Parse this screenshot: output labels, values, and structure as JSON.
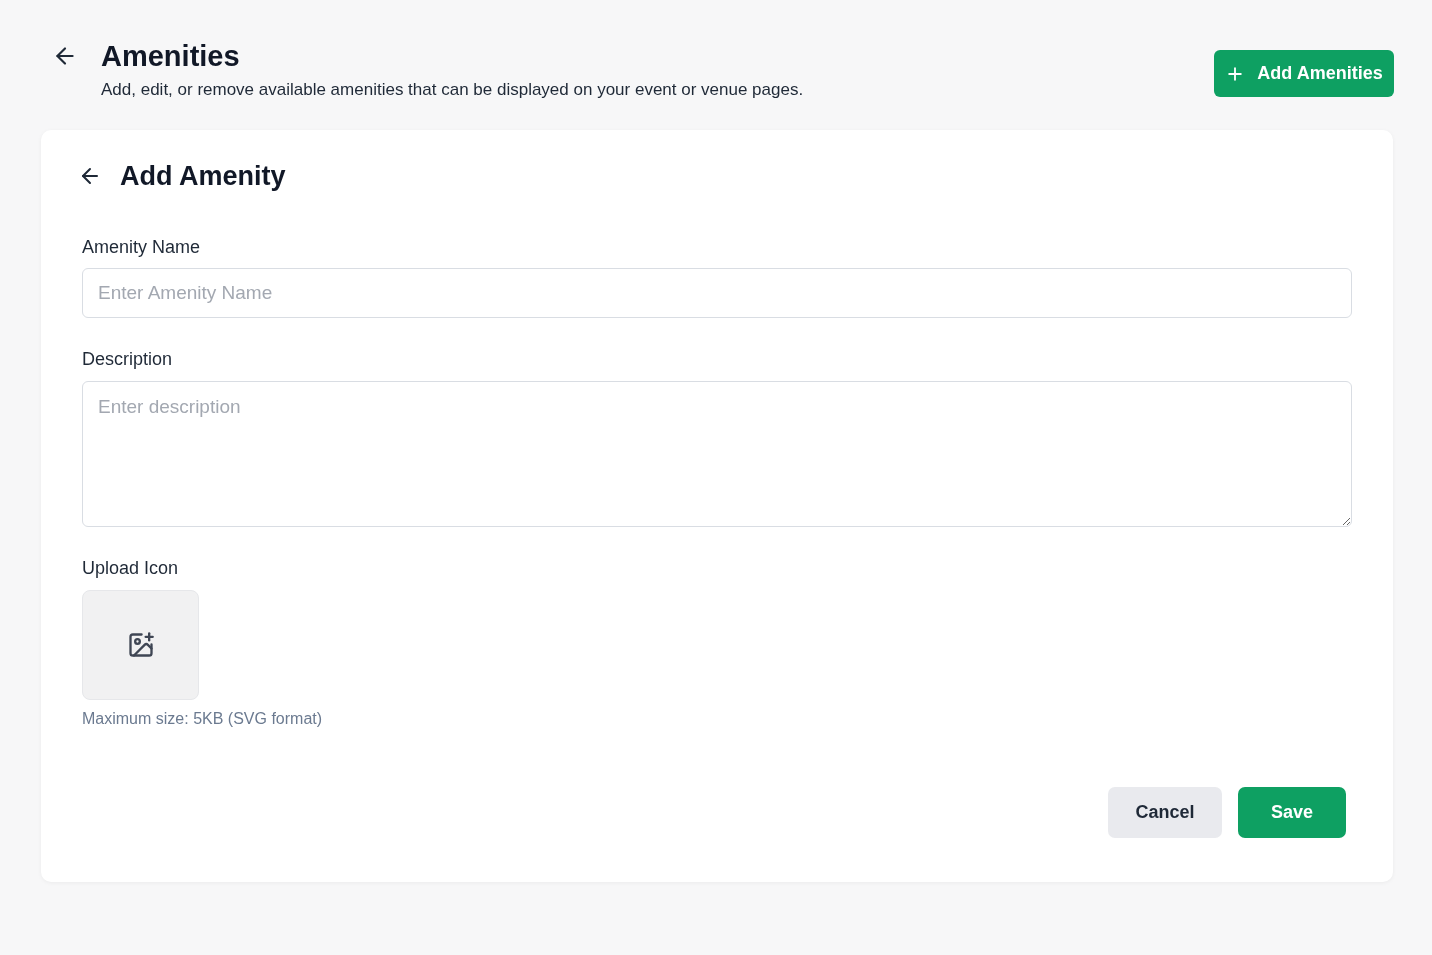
{
  "header": {
    "title": "Amenities",
    "subtitle": "Add, edit, or remove available amenities that can be displayed on your event or venue pages.",
    "add_button": {
      "label": "Add Amenities"
    }
  },
  "form": {
    "title": "Add Amenity",
    "fields": [
      {
        "kind": "text",
        "label": "Amenity Name",
        "placeholder": "Enter Amenity Name"
      },
      {
        "kind": "textarea",
        "label": "Description",
        "placeholder": "Enter description"
      },
      {
        "kind": "upload",
        "label": "Upload Icon",
        "hint": "Maximum size: 5KB (SVG format)"
      }
    ],
    "buttons": [
      {
        "kind": "secondary",
        "label": "Cancel"
      },
      {
        "kind": "primary",
        "label": "Save"
      }
    ]
  }
}
